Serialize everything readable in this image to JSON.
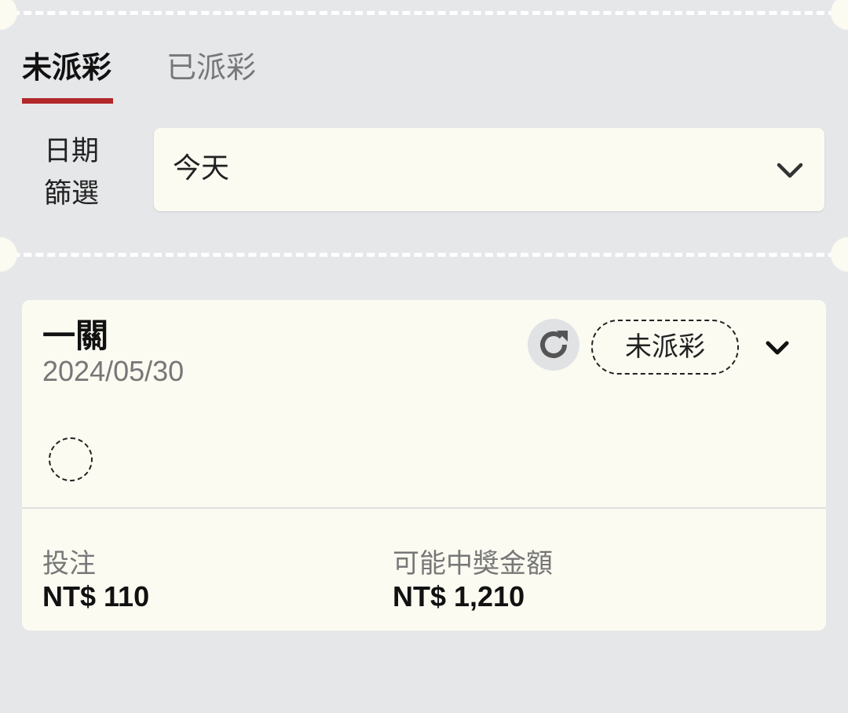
{
  "tabs": [
    {
      "label": "未派彩",
      "active": true
    },
    {
      "label": "已派彩",
      "active": false
    }
  ],
  "filter": {
    "label_line1": "日期",
    "label_line2": "篩選",
    "selected": "今天"
  },
  "bet_card": {
    "type": "一關",
    "date": "2024/05/30",
    "status": "未派彩",
    "stake_label": "投注",
    "stake_value": "NT$ 110",
    "payout_label": "可能中獎金額",
    "payout_value": "NT$ 1,210"
  },
  "icons": {
    "refresh": "refresh-icon",
    "dropdown": "chevron-down-icon"
  },
  "colors": {
    "accent": "#b1272a",
    "background": "#e6e7e9",
    "card": "#fbfbf2"
  }
}
